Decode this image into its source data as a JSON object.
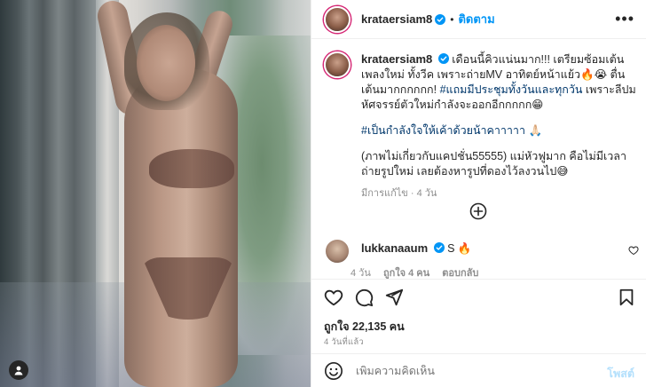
{
  "post": {
    "username": "krataersiam8",
    "follow_label": "ติดตาม",
    "more_label": "•••",
    "caption": {
      "line1": "เดือนนี้คิวแน่นมาก!!! เตรียมซ้อมเต้นเพลงใหม่ ทั้งวีค เพราะถ่ายMV อาทิตย์หน้าแย้ว🔥😭 ตื่นเต้นมากกกกกก!",
      "hashtag1": "#แถมมีประชุมทั้งวันและทุกวัน",
      "line2": " เพราะลีปมหัศจรรย์ตัวใหม่กำลังจะออกอีกกกกก😁",
      "hashtag2": "#เป็นกำลังใจให้เค้าด้วยน้าคาาาาา",
      "line2_tail": " 🙏🏻",
      "line3": "(ภาพไม่เกี่ยวกับแคปชั่น55555) แม่หัวฟูมาก คือไม่มีเวลาถ่ายรูปใหม่ เลยต้องหารูปที่ดองไว้ลงวนไป😅",
      "meta": "มีการแก้ไข · 4 วัน"
    },
    "comment": {
      "username": "lukkanaaum",
      "text": "S 🔥",
      "time": "4 วัน",
      "likes": "ถูกใจ 4 คน",
      "reply": "ตอบกลับ"
    },
    "likes_text": "ถูกใจ 22,135 คน",
    "date_text": "4 วันที่แล้ว",
    "composer": {
      "placeholder": "เพิ่มความคิดเห็น",
      "post_label": "โพสต์"
    }
  },
  "colors": {
    "link_blue": "#0095f6",
    "hashtag": "#00376b",
    "muted": "#8e8e8e"
  },
  "icons": [
    "user-icon",
    "verified-icon",
    "more-icon",
    "add-circle-icon",
    "heart-icon",
    "comment-icon",
    "share-icon",
    "bookmark-icon",
    "emoji-icon"
  ]
}
